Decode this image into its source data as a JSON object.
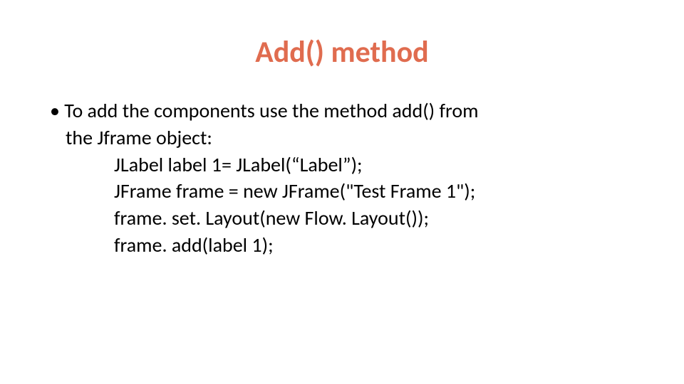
{
  "title": "Add() method",
  "bullet": {
    "marker": "•",
    "line1": "To add the components use the method add() from",
    "line2": "the Jframe object:"
  },
  "code": {
    "l1": "JLabel label 1= JLabel(“Label”);",
    "l2": "JFrame frame = new JFrame(\"Test Frame 1\");",
    "l3": "frame. set. Layout(new Flow. Layout());",
    "l4": "frame. add(label 1);"
  }
}
